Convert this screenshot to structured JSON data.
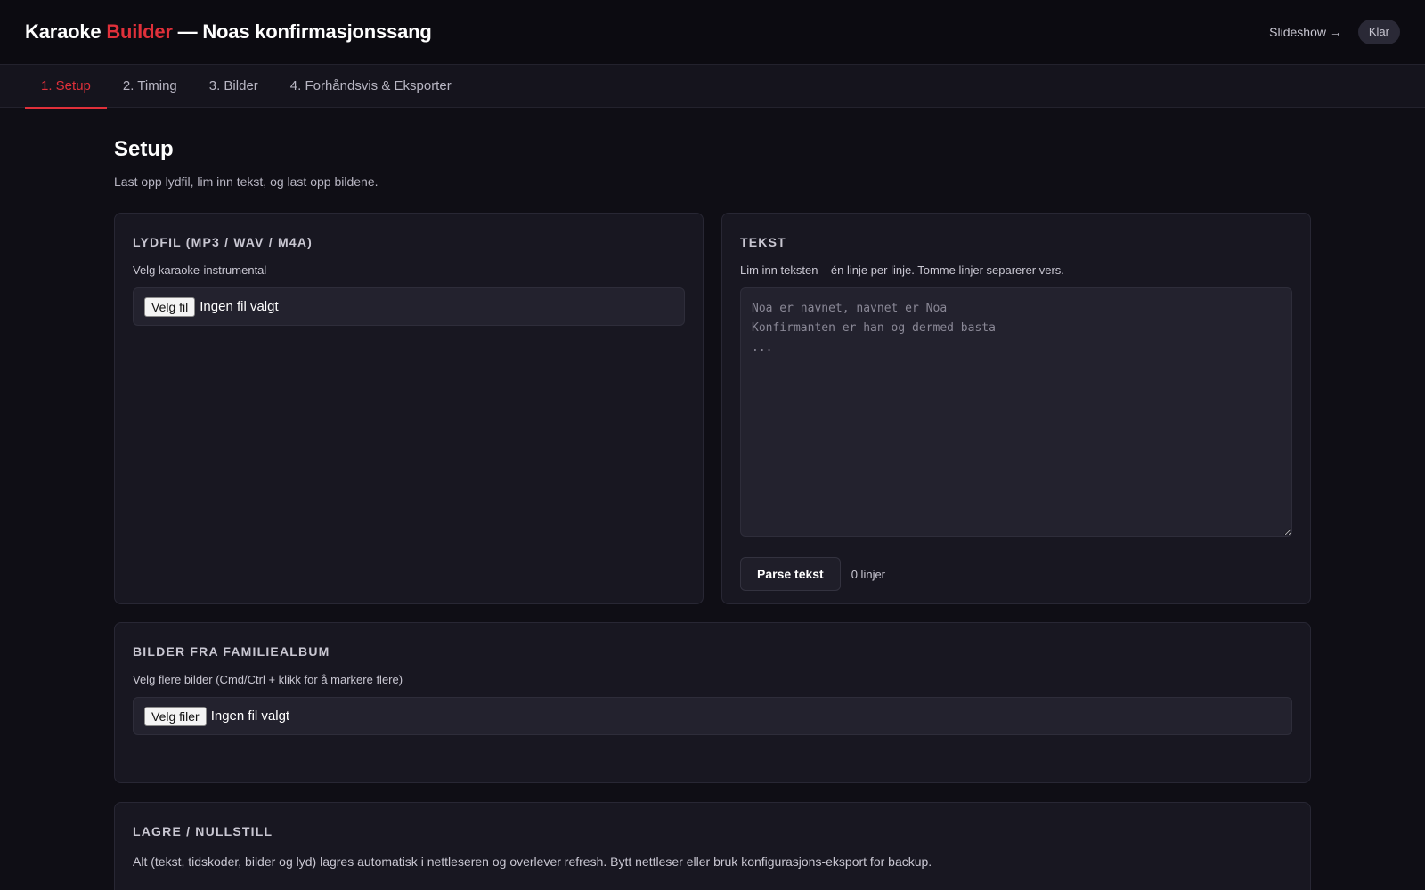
{
  "header": {
    "title_prefix": "Karaoke ",
    "title_accent": "Builder",
    "title_suffix": " — Noas konfirmasjonssang",
    "slideshow_link": "Slideshow →",
    "status": "Klar"
  },
  "tabs": [
    {
      "label": "1. Setup",
      "active": true
    },
    {
      "label": "2. Timing",
      "active": false
    },
    {
      "label": "3. Bilder",
      "active": false
    },
    {
      "label": "4. Forhåndsvis & Eksporter",
      "active": false
    }
  ],
  "page": {
    "title": "Setup",
    "subtitle": "Last opp lydfil, lim inn tekst, og last opp bildene."
  },
  "audio_card": {
    "heading": "Lydfil (MP3 / WAV / M4A)",
    "label": "Velg karaoke-instrumental",
    "button": "Velg fil",
    "status": "Ingen fil valgt"
  },
  "lyrics_card": {
    "heading": "Tekst",
    "label": "Lim inn teksten – én linje per linje. Tomme linjer separerer vers.",
    "placeholder": "Noa er navnet, navnet er Noa\nKonfirmanten er han og dermed basta\n...",
    "parse_button": "Parse tekst",
    "line_count": "0 linjer"
  },
  "images_card": {
    "heading": "Bilder fra familiealbum",
    "label": "Velg flere bilder (Cmd/Ctrl + klikk for å markere flere)",
    "button": "Velg filer",
    "status": "Ingen fil valgt"
  },
  "save_card": {
    "heading": "Lagre / Nullstill",
    "text": "Alt (tekst, tidskoder, bilder og lyd) lagres automatisk i nettleseren og overlever refresh. Bytt nettleser eller bruk konfigurasjons-eksport for backup."
  },
  "colors": {
    "accent": "#e0303a",
    "background": "#0f0e15",
    "card": "#181721"
  }
}
